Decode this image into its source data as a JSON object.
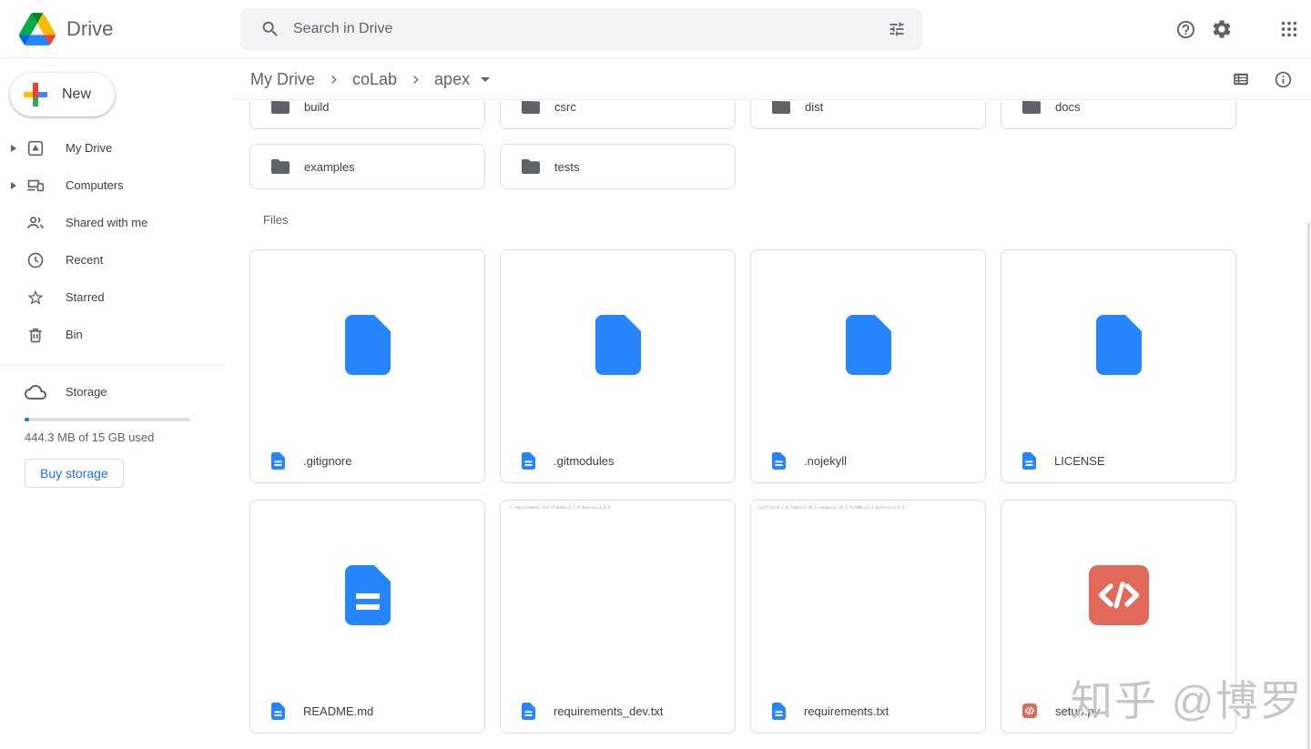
{
  "header": {
    "app_title": "Drive",
    "search_placeholder": "Search in Drive",
    "icons": [
      "drive-logo-icon",
      "search-icon",
      "filter-options-icon",
      "help-icon",
      "settings-icon",
      "apps-grid-icon"
    ]
  },
  "sidebar": {
    "new_button_label": "New",
    "items": [
      {
        "label": "My Drive",
        "icon": "my-drive-icon",
        "expandable": true
      },
      {
        "label": "Computers",
        "icon": "computers-icon",
        "expandable": true
      },
      {
        "label": "Shared with me",
        "icon": "shared-with-me-icon",
        "expandable": false
      },
      {
        "label": "Recent",
        "icon": "recent-icon",
        "expandable": false
      },
      {
        "label": "Starred",
        "icon": "starred-icon",
        "expandable": false
      },
      {
        "label": "Bin",
        "icon": "bin-icon",
        "expandable": false
      }
    ],
    "storage": {
      "label": "Storage",
      "icon": "cloud-icon",
      "used_percent": 2.9,
      "usage_text": "444.3 MB of 15 GB used",
      "buy_button_label": "Buy storage"
    }
  },
  "breadcrumb": {
    "items": [
      "My Drive",
      "coLab",
      "apex"
    ]
  },
  "toolbar_icons": [
    "list-view-icon",
    "info-icon"
  ],
  "content": {
    "folders_top_row": [
      "build",
      "csrc",
      "dist",
      "docs"
    ],
    "folders_second_row": [
      "examples",
      "tests"
    ],
    "files_section_label": "Files",
    "files": [
      {
        "name": ".gitignore",
        "type": "doc"
      },
      {
        "name": ".gitmodules",
        "type": "doc"
      },
      {
        "name": ".nojekyll",
        "type": "doc"
      },
      {
        "name": "LICENSE",
        "type": "doc"
      },
      {
        "name": "README.md",
        "type": "text-doc"
      },
      {
        "name": "requirements_dev.txt",
        "type": "text-preview",
        "preview": "-r requirements.txt flake8>=3.7.9 Sphinx>=3.0.3"
      },
      {
        "name": "requirements.txt",
        "type": "text-preview",
        "preview": "cxxfilt>=0.2.0 tqdm>=4.28.1 numpy>=1.15.3 PyYAML>=5.1 pytest>=3.5.1"
      },
      {
        "name": "setup.py",
        "type": "code"
      }
    ]
  },
  "watermark_text": "知乎 @博罗",
  "colors": {
    "accent_blue": "#1a73e8",
    "file_icon_blue": "#2684fc",
    "code_icon_red": "#e2685a",
    "icon_gray": "#5f6368",
    "border_gray": "#dadce0",
    "logo": {
      "dark_blue": "#0066da",
      "green": "#00ac47",
      "red": "#ea4335",
      "dark_green": "#00832d",
      "blue": "#2684fc",
      "yellow": "#ffba00"
    },
    "plus": {
      "red": "#ea4335",
      "blue": "#4285f4",
      "green": "#34a853",
      "yellow": "#fbbc04"
    }
  }
}
